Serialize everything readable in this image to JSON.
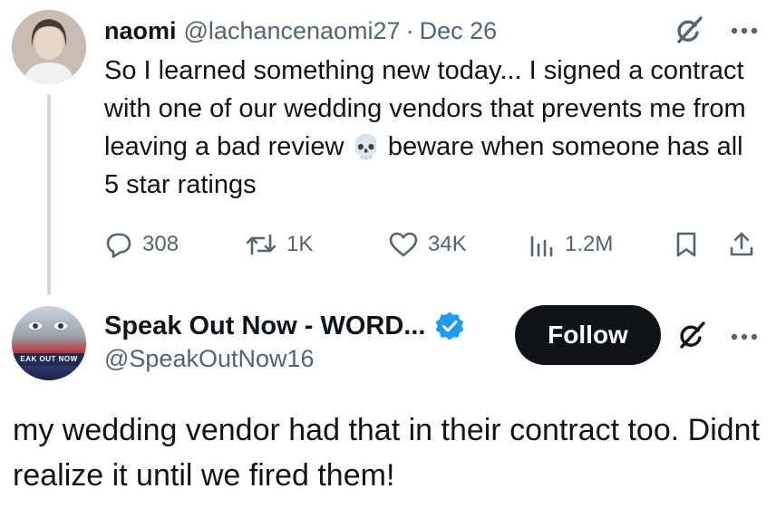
{
  "tweet1": {
    "author_name": "naomi",
    "handle": "@lachancenaomi27",
    "separator": "·",
    "date": "Dec 26",
    "text_before_emoji": "So I learned something new today... I signed a contract with one of our wedding vendors that prevents me from leaving a bad review ",
    "emoji": "💀",
    "text_after_emoji": " beware when someone has all 5 star ratings",
    "stats": {
      "replies": "308",
      "reposts": "1K",
      "likes": "34K",
      "views": "1.2M"
    }
  },
  "tweet2": {
    "author_name": "Speak Out Now - WORD...",
    "handle": "@SpeakOutNow16",
    "follow_label": "Follow",
    "avatar_caption": "EAK OUT NOW",
    "text": "my wedding vendor had that in their contract too. Didnt realize it until we fired them!"
  },
  "icons": {
    "grok": "grok-icon",
    "more": "more-icon",
    "reply": "reply-icon",
    "repost": "repost-icon",
    "like": "heart-icon",
    "views": "analytics-icon",
    "bookmark": "bookmark-icon",
    "share": "share-icon",
    "verified": "verified-badge-icon"
  },
  "colors": {
    "primary_text": "#0f1419",
    "secondary_text": "#536471",
    "verified_blue": "#1d9bf0",
    "follow_bg": "#0f1419",
    "thread_line": "#cfd9de"
  }
}
